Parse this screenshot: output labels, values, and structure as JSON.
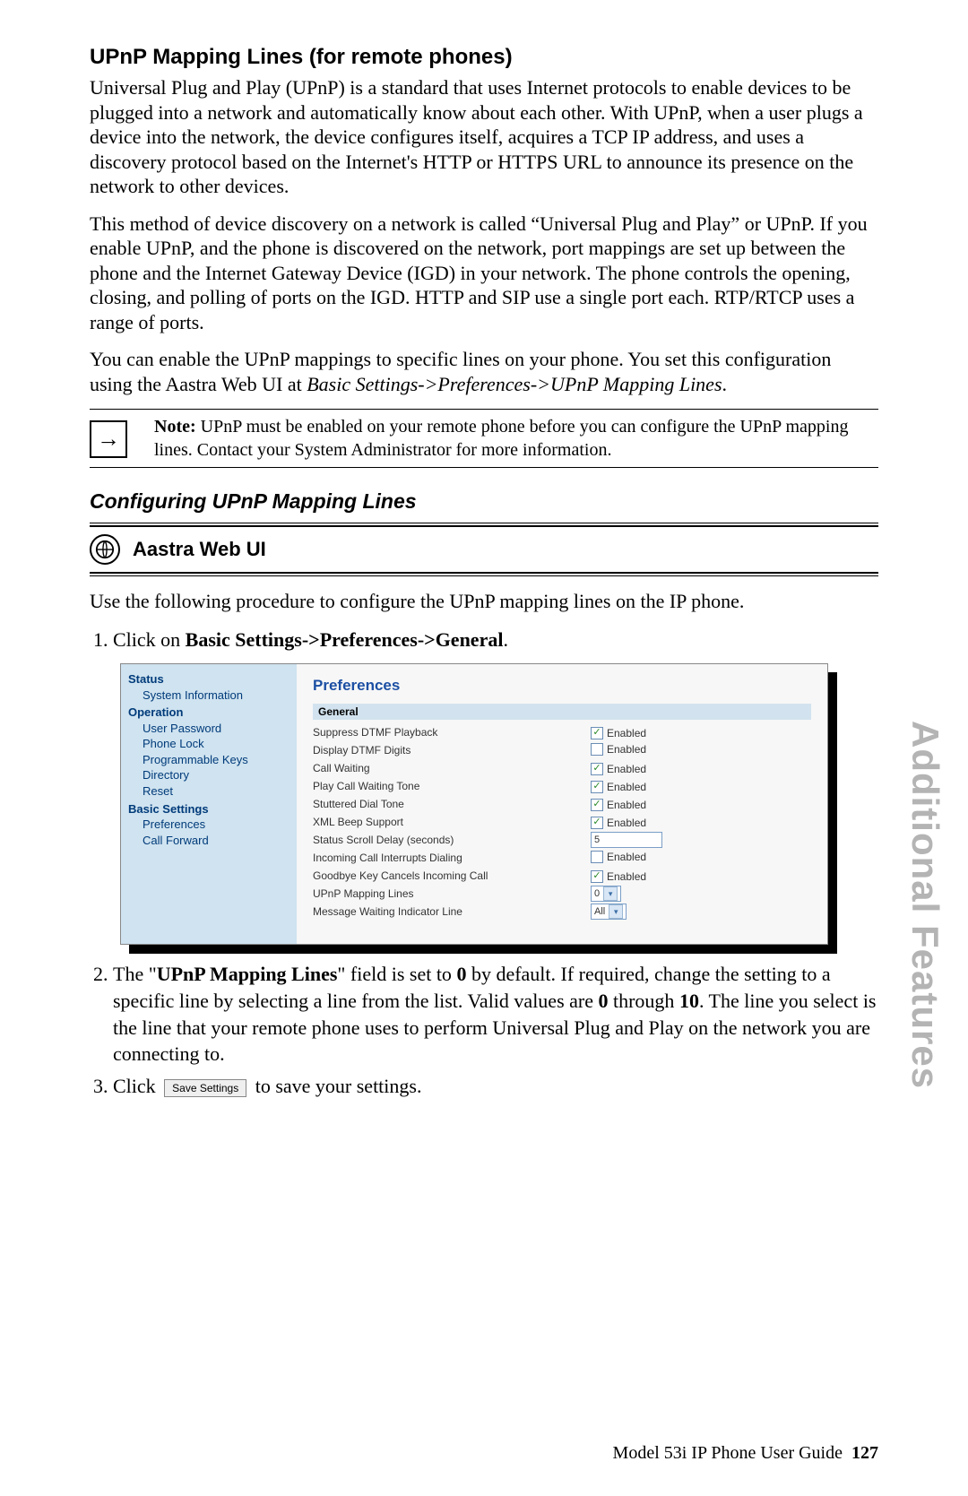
{
  "headings": {
    "h1": "UPnP Mapping Lines (for remote phones)",
    "sub": "Configuring UPnP Mapping Lines",
    "webui": "Aastra Web UI"
  },
  "paragraphs": {
    "p1": "Universal Plug and Play (UPnP) is a standard that uses Internet protocols to enable devices to be plugged into a network and automatically know about each other. With UPnP, when a user plugs a device into the network, the device configures itself, acquires a TCP IP address, and uses a discovery protocol based on the Internet's HTTP or HTTPS URL to announce its presence on the network to other devices.",
    "p2": "This method of device discovery on a network is called “Universal Plug and Play” or UPnP. If you enable UPnP, and the phone is discovered on the network, port mappings are set up between the phone and the Internet Gateway Device (IGD) in your network. The phone controls the opening, closing, and polling of ports on the IGD. HTTP and SIP use a single port each. RTP/RTCP uses a range of ports.",
    "p3a": "You can enable the UPnP mappings to specific lines on your phone. You set this configuration using the Aastra Web UI at ",
    "p3b": "Basic Settings->Preferences->UPnP Mapping Lines",
    "p3c": ".",
    "intro": "Use the following procedure to configure the UPnP mapping lines on the IP phone."
  },
  "note": {
    "label": "Note:",
    "text": " UPnP must be enabled on your remote phone before you can configure the UPnP mapping lines. Contact your System Administrator for more information."
  },
  "steps": {
    "s1a": "Click on ",
    "s1b": "Basic Settings->Preferences->General",
    "s1c": ".",
    "s2a": "The \"",
    "s2b": "UPnP Mapping Lines",
    "s2c": "\" field is set to ",
    "s2d": "0",
    "s2e": " by default. If required, change the setting to a specific line by selecting a line from the list. Valid values are ",
    "s2f": "0",
    "s2g": " through ",
    "s2h": "10",
    "s2i": ". The line you select is the line that your remote phone uses to perform Universal Plug and Play on the network you are connecting to.",
    "s3a": "Click ",
    "s3b": "Save Settings",
    "s3c": " to save your settings."
  },
  "shot": {
    "nav": {
      "status": "Status",
      "sysinfo": "System Information",
      "operation": "Operation",
      "userpw": "User Password",
      "phonelock": "Phone Lock",
      "progkeys": "Programmable Keys",
      "directory": "Directory",
      "reset": "Reset",
      "basic": "Basic Settings",
      "prefs": "Preferences",
      "callfwd": "Call Forward"
    },
    "title": "Preferences",
    "general": "General",
    "rows": [
      {
        "label": "Suppress DTMF Playback",
        "type": "cb",
        "checked": true,
        "text": "Enabled"
      },
      {
        "label": "Display DTMF Digits",
        "type": "cb",
        "checked": false,
        "text": "Enabled"
      },
      {
        "label": "Call Waiting",
        "type": "cb",
        "checked": true,
        "text": "Enabled"
      },
      {
        "label": "Play Call Waiting Tone",
        "type": "cb",
        "checked": true,
        "text": "Enabled"
      },
      {
        "label": "Stuttered Dial Tone",
        "type": "cb",
        "checked": true,
        "text": "Enabled"
      },
      {
        "label": "XML Beep Support",
        "type": "cb",
        "checked": true,
        "text": "Enabled"
      },
      {
        "label": "Status Scroll Delay (seconds)",
        "type": "num",
        "value": "5"
      },
      {
        "label": "Incoming Call Interrupts Dialing",
        "type": "cb",
        "checked": false,
        "text": "Enabled"
      },
      {
        "label": "Goodbye Key Cancels Incoming Call",
        "type": "cb",
        "checked": true,
        "text": "Enabled"
      },
      {
        "label": "UPnP Mapping Lines",
        "type": "sel",
        "value": "0"
      },
      {
        "label": "Message Waiting Indicator Line",
        "type": "sel",
        "value": "All"
      }
    ]
  },
  "side": "Additional Features",
  "footer": {
    "text": "Model 53i IP Phone User Guide",
    "page": "127"
  }
}
